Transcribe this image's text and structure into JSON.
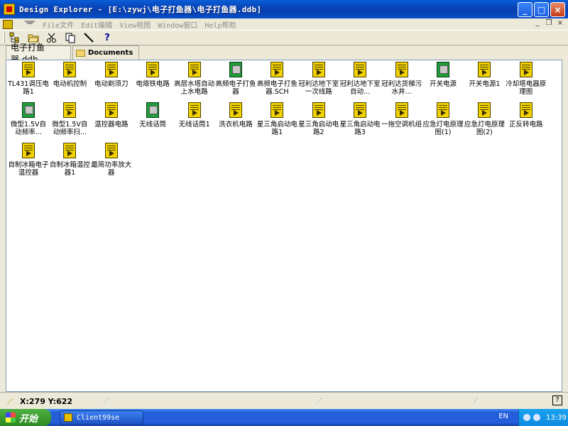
{
  "window": {
    "title": "Design Explorer - [E:\\zywj\\电子打鱼器\\电子打鱼器.ddb]",
    "minimize": "_",
    "maximize": "□",
    "close": "×"
  },
  "menu": {
    "items": [
      "File文件",
      "Edit编辑",
      "View视图",
      "Window窗口",
      "Help帮助"
    ],
    "mdi_minimize": "_",
    "mdi_restore": "❐",
    "mdi_close": "×"
  },
  "toolbar": {
    "icons": [
      "explorer-tree-icon",
      "open-folder-icon",
      "cut-icon",
      "copy-icon",
      "pencil-icon",
      "help-icon"
    ],
    "help_label": "?"
  },
  "tabs": [
    {
      "label": "电子打鱼器.ddb"
    },
    {
      "label": "Documents"
    }
  ],
  "documents": [
    {
      "label": "TL431调压电路1",
      "type": "sch"
    },
    {
      "label": "电动机控制",
      "type": "sch"
    },
    {
      "label": "电动剃须刀",
      "type": "sch"
    },
    {
      "label": "电烙铁电路",
      "type": "sch"
    },
    {
      "label": "高层水塔自动上水电路",
      "type": "sch"
    },
    {
      "label": "高频电子打鱼器",
      "type": "pcb"
    },
    {
      "label": "高频电子打鱼器.SCH",
      "type": "sch"
    },
    {
      "label": "冠利达地下室一次线路",
      "type": "sch"
    },
    {
      "label": "冠利达地下室自动...",
      "type": "sch"
    },
    {
      "label": "冠利达货梯污水井...",
      "type": "sch"
    },
    {
      "label": "开关电源",
      "type": "pcb"
    },
    {
      "label": "开关电源1",
      "type": "sch"
    },
    {
      "label": "冷却塔电器原理图",
      "type": "sch"
    },
    {
      "label": "微型1.5V自动频率...",
      "type": "pcb"
    },
    {
      "label": "微型1.5V自动频率扫...",
      "type": "sch"
    },
    {
      "label": "温控器电路",
      "type": "sch"
    },
    {
      "label": "无线话筒",
      "type": "pcb"
    },
    {
      "label": "无线话筒1",
      "type": "sch"
    },
    {
      "label": "洗衣机电路",
      "type": "sch"
    },
    {
      "label": "星三角启动电路1",
      "type": "sch"
    },
    {
      "label": "星三角启动电路2",
      "type": "sch"
    },
    {
      "label": "星三角启动电路3",
      "type": "sch"
    },
    {
      "label": "一拖空调机组",
      "type": "sch"
    },
    {
      "label": "应急灯电原理图(1)",
      "type": "sch"
    },
    {
      "label": "应急灯电原理图(2)",
      "type": "sch"
    },
    {
      "label": "正反转电路",
      "type": "sch"
    },
    {
      "label": "自制冰箱电子温控器",
      "type": "sch"
    },
    {
      "label": "自制冰箱温控器1",
      "type": "sch"
    },
    {
      "label": "最简功率放大器",
      "type": "sch"
    }
  ],
  "status": {
    "coordinates": "X:279 Y:622",
    "help": "?"
  },
  "taskbar": {
    "start_label": "开始",
    "task_label": "Client99se",
    "language": "EN",
    "clock": "13:39"
  }
}
